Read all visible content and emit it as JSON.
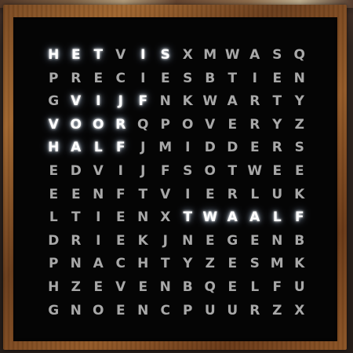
{
  "word_clock": {
    "rows": [
      "HETVISXMWASQ",
      "PRECIESBTIEN",
      "GVIJFNKWARTY",
      "VOORQPOVERYZ",
      "HALFJMIDDERS",
      "EDVIJFSOTWEE",
      "EENFTVIERLUK",
      "LTIENXTWAALF",
      "DRIEKJNEGENB",
      "PNACHTYZESMK",
      "HZEVENBQELFU",
      "GNOENCPUURZX"
    ],
    "lit_words": [
      {
        "row": 0,
        "start": 0,
        "text": "HET"
      },
      {
        "row": 0,
        "start": 4,
        "text": "IS"
      },
      {
        "row": 2,
        "start": 1,
        "text": "VIJF"
      },
      {
        "row": 3,
        "start": 0,
        "text": "VOOR"
      },
      {
        "row": 4,
        "start": 0,
        "text": "HALF"
      },
      {
        "row": 7,
        "start": 6,
        "text": "TWAALF"
      }
    ],
    "colors": {
      "face": "#050505",
      "unlit_letter": "#a8a8a8",
      "lit_letter": "#ffffff",
      "frame": "#8d5526"
    }
  }
}
